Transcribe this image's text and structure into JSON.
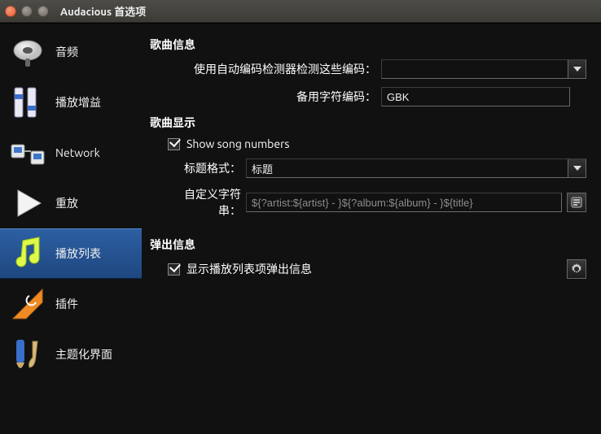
{
  "window": {
    "title": "Audacious 首选项"
  },
  "sidebar": {
    "items": [
      {
        "label": "音频"
      },
      {
        "label": "播放增益"
      },
      {
        "label": "Network"
      },
      {
        "label": "重放"
      },
      {
        "label": "播放列表"
      },
      {
        "label": "插件"
      },
      {
        "label": "主题化界面"
      }
    ],
    "selected_index": 4
  },
  "content": {
    "song_info": {
      "heading": "歌曲信息",
      "auto_detect_label": "使用自动编码检测器检测这些编码：",
      "auto_detect_value": "",
      "fallback_label": "备用字符编码：",
      "fallback_value": "GBK"
    },
    "song_display": {
      "heading": "歌曲显示",
      "show_numbers_label": "Show song numbers",
      "show_numbers_checked": true,
      "title_format_label": "标题格式：",
      "title_format_value": "标题",
      "custom_string_label": "自定义字符串：",
      "custom_string_value": "${?artist:${artist} - }${?album:${album} - }${title}"
    },
    "popup_info": {
      "heading": "弹出信息",
      "show_popup_label": "显示播放列表项弹出信息",
      "show_popup_checked": true
    }
  }
}
